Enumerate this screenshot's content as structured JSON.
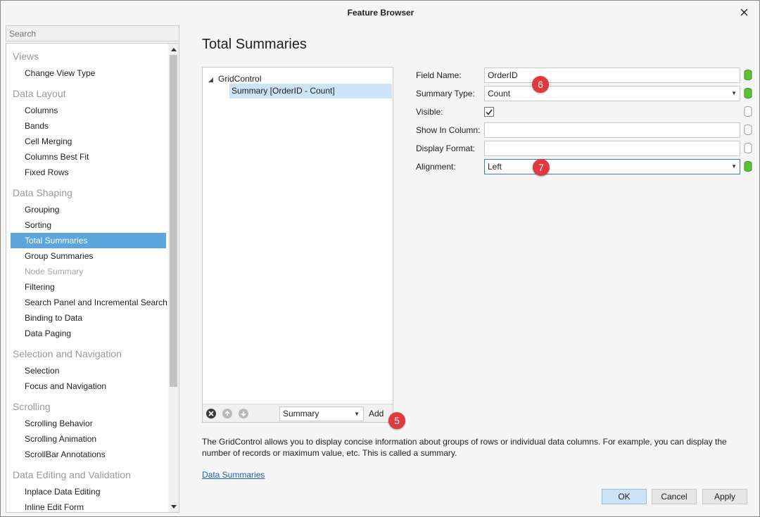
{
  "window": {
    "title": "Feature Browser"
  },
  "nav": {
    "search_placeholder": "Search",
    "groups": [
      {
        "label": "Views",
        "items": [
          {
            "label": "Change View Type"
          }
        ]
      },
      {
        "label": "Data Layout",
        "items": [
          {
            "label": "Columns"
          },
          {
            "label": "Bands"
          },
          {
            "label": "Cell Merging"
          },
          {
            "label": "Columns Best Fit"
          },
          {
            "label": "Fixed Rows"
          }
        ]
      },
      {
        "label": "Data Shaping",
        "items": [
          {
            "label": "Grouping"
          },
          {
            "label": "Sorting"
          },
          {
            "label": "Total Summaries",
            "selected": true
          },
          {
            "label": "Group Summaries"
          },
          {
            "label": "Node Summary",
            "disabled": true
          },
          {
            "label": "Filtering"
          },
          {
            "label": "Search Panel and Incremental Search"
          },
          {
            "label": "Binding to Data"
          },
          {
            "label": "Data Paging"
          }
        ]
      },
      {
        "label": "Selection and Navigation",
        "items": [
          {
            "label": "Selection"
          },
          {
            "label": "Focus and Navigation"
          }
        ]
      },
      {
        "label": "Scrolling",
        "items": [
          {
            "label": "Scrolling Behavior"
          },
          {
            "label": "Scrolling Animation"
          },
          {
            "label": "ScrollBar Annotations"
          }
        ]
      },
      {
        "label": "Data Editing and Validation",
        "items": [
          {
            "label": "Inplace Data Editing"
          },
          {
            "label": "Inline Edit Form"
          }
        ]
      }
    ]
  },
  "main": {
    "title": "Total Summaries",
    "tree": {
      "root": "GridControl",
      "child": "Summary [OrderID - Count]"
    },
    "toolbar": {
      "summary_type": "Summary",
      "add_label": "Add"
    },
    "properties": {
      "field_name": {
        "label": "Field Name:",
        "value": "OrderID"
      },
      "summary_type": {
        "label": "Summary Type:",
        "value": "Count"
      },
      "visible": {
        "label": "Visible:",
        "checked": true
      },
      "show_in_column": {
        "label": "Show In Column:",
        "value": ""
      },
      "display_format": {
        "label": "Display Format:",
        "value": ""
      },
      "alignment": {
        "label": "Alignment:",
        "value": "Left"
      }
    },
    "description": "The GridControl allows you to display concise information about groups of rows or individual data columns. For example, you can display the number of records or maximum value, etc. This is called a summary.",
    "link": "Data Summaries"
  },
  "markers": {
    "add": "5",
    "field_name": "6",
    "alignment": "7"
  },
  "buttons": {
    "ok": "OK",
    "cancel": "Cancel",
    "apply": "Apply"
  },
  "colors": {
    "selection": "#5aa5dd",
    "marker": "#e0393e",
    "db_active": "#5bc236",
    "link": "#1e64b4"
  }
}
